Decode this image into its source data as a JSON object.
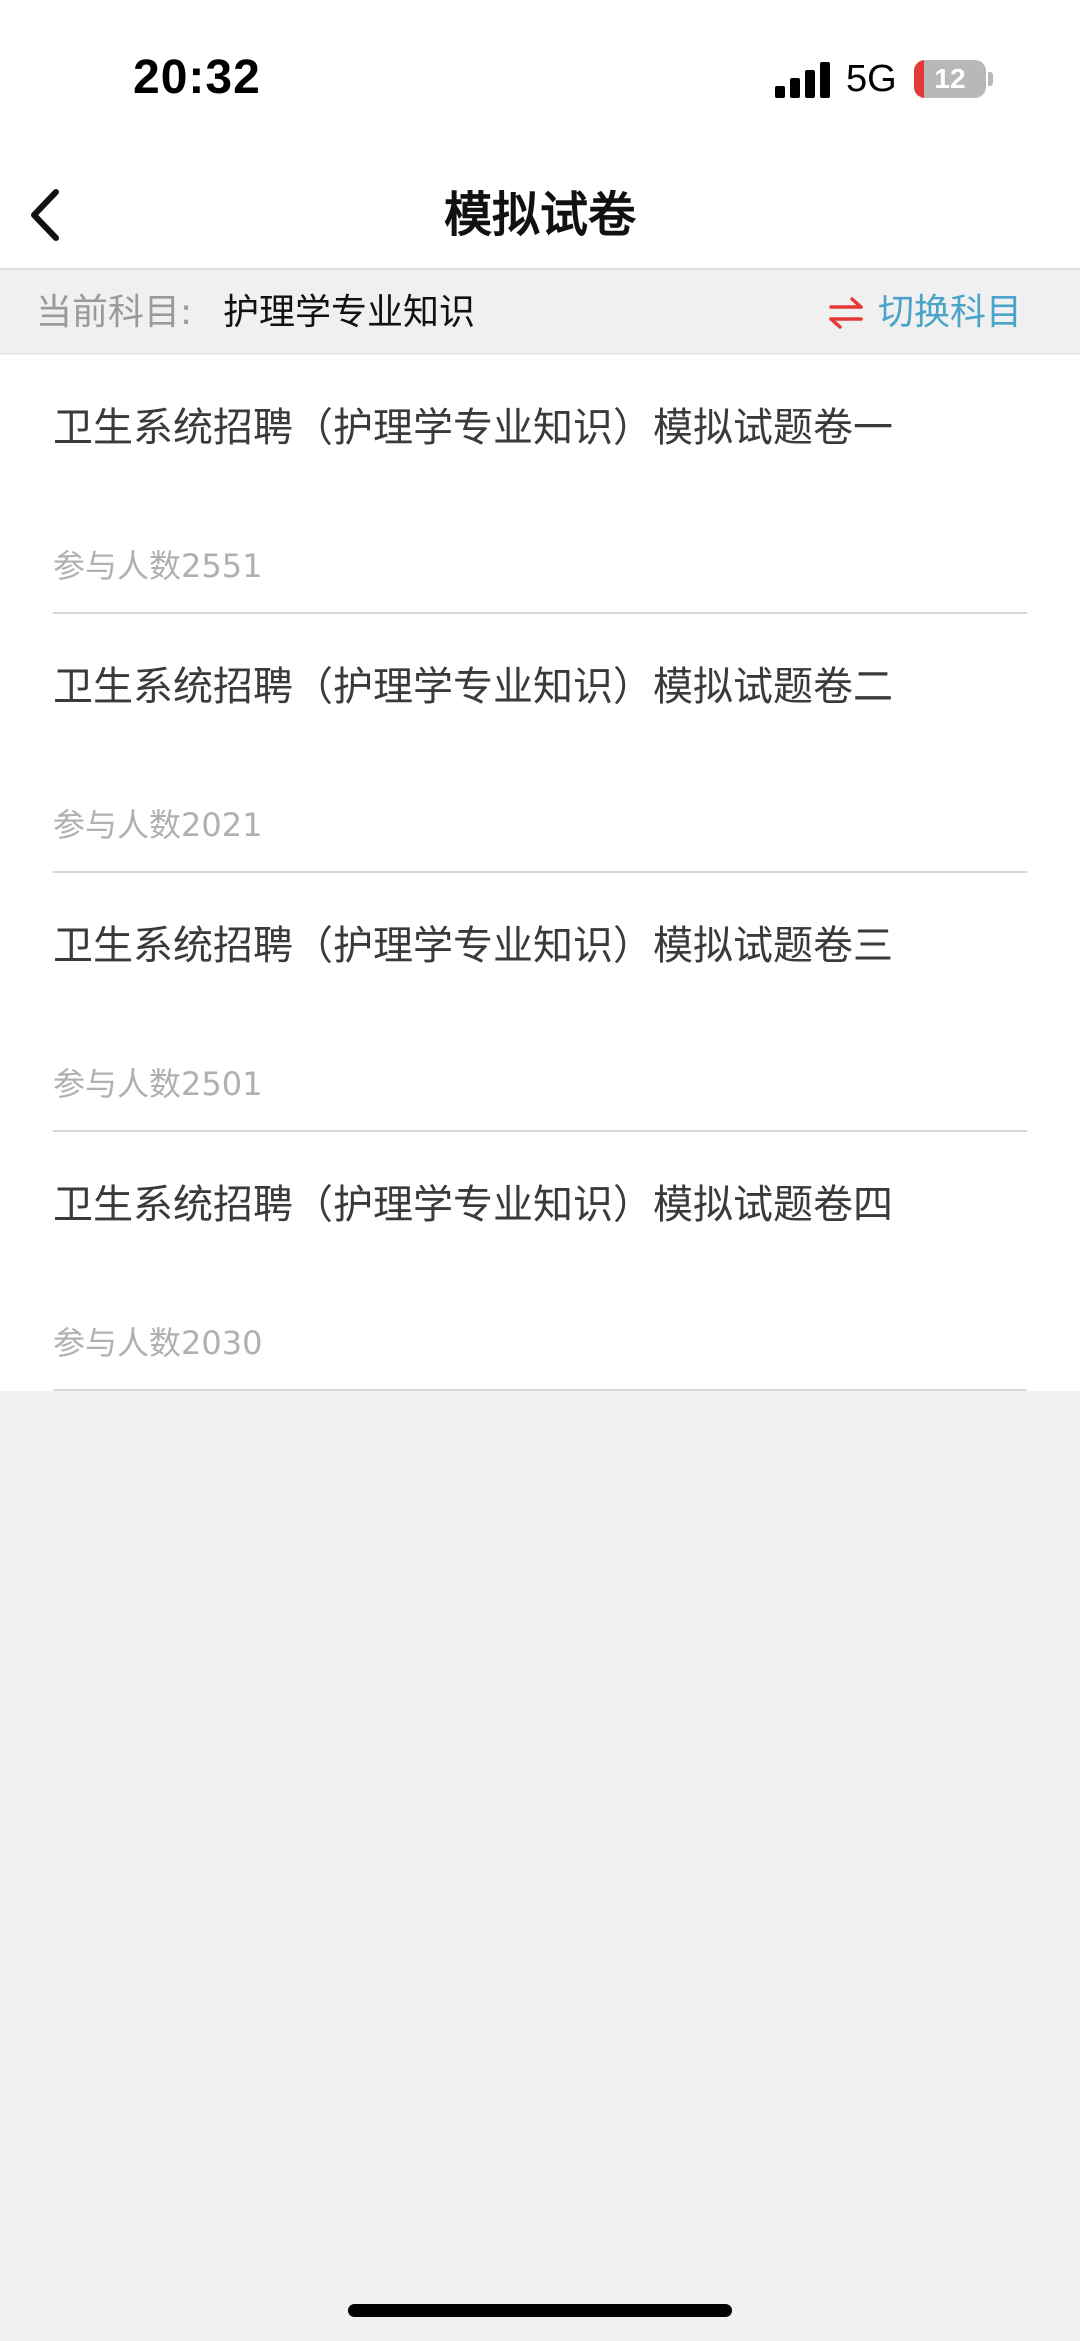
{
  "status_bar": {
    "time": "20:32",
    "network": "5G",
    "battery": "12"
  },
  "nav": {
    "title": "模拟试卷",
    "back_icon": "chevron-left-icon"
  },
  "subject_bar": {
    "label": "当前科目:",
    "value": "护理学专业知识",
    "switch_icon": "swap-arrows-icon",
    "switch_label": "切换科目"
  },
  "papers": [
    {
      "title": "卫生系统招聘（护理学专业知识）模拟试题卷一",
      "count": "参与人数2551"
    },
    {
      "title": "卫生系统招聘（护理学专业知识）模拟试题卷二",
      "count": "参与人数2021"
    },
    {
      "title": "卫生系统招聘（护理学专业知识）模拟试题卷三",
      "count": "参与人数2501"
    },
    {
      "title": "卫生系统招聘（护理学专业知识）模拟试题卷四",
      "count": "参与人数2030"
    }
  ],
  "colors": {
    "accent": "#4aa3c8",
    "switch_icon": "#e53935",
    "battery_low": "#e53935"
  }
}
